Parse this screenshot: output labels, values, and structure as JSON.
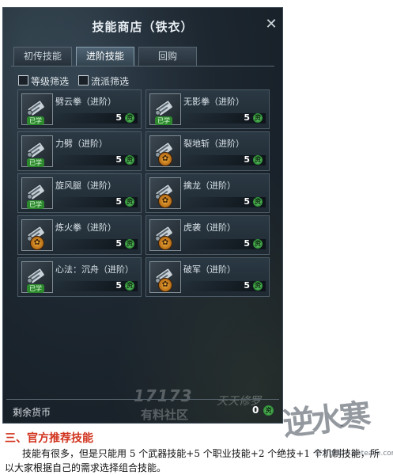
{
  "window": {
    "title": "技能商店（铁衣）",
    "close_glyph": "✕"
  },
  "tabs": [
    {
      "label": "初传技能",
      "active": false
    },
    {
      "label": "进阶技能",
      "active": true
    },
    {
      "label": "回购",
      "active": false
    }
  ],
  "filters": [
    {
      "label": "等级筛选",
      "checked": false
    },
    {
      "label": "流派筛选",
      "checked": false
    }
  ],
  "skills": [
    {
      "name": "劈云拳（进阶）",
      "cost": "5",
      "status": "已学",
      "icon": "scroll-learned-icon"
    },
    {
      "name": "无影拳（进阶）",
      "cost": "5",
      "status": "已学",
      "icon": "scroll-learned-icon"
    },
    {
      "name": "力劈（进阶）",
      "cost": "5",
      "status": "已学",
      "icon": "scroll-learned-icon"
    },
    {
      "name": "裂地斩（进阶）",
      "cost": "5",
      "status": "",
      "icon": "scroll-locked-icon"
    },
    {
      "name": "旋风腿（进阶）",
      "cost": "5",
      "status": "已学",
      "icon": "scroll-learned-icon"
    },
    {
      "name": "擒龙（进阶）",
      "cost": "5",
      "status": "",
      "icon": "scroll-locked-icon"
    },
    {
      "name": "炼火拳（进阶）",
      "cost": "5",
      "status": "",
      "icon": "scroll-locked-icon"
    },
    {
      "name": "虎袭（进阶）",
      "cost": "5",
      "status": "",
      "icon": "scroll-locked-icon"
    },
    {
      "name": "心法：沉舟（进阶）",
      "cost": "5",
      "status": "已学",
      "icon": "scroll-learned-icon"
    },
    {
      "name": "破军（进阶）",
      "cost": "5",
      "status": "",
      "icon": "scroll-locked-icon"
    }
  ],
  "currency_glyph": "资",
  "footer": {
    "remaining_label": "剩余货币",
    "remaining_value": "0"
  },
  "watermarks": {
    "site_logo": "17173",
    "slogan": "有料社区",
    "calligraphy_left": "天天修罗",
    "calligraphy_right": "逆水寒",
    "forum": "官方论坛 n.netease.com"
  },
  "article": {
    "heading": "三、官方推荐技能",
    "paragraph": "技能有很多，但是只能用 5 个武器技能+5 个职业技能+2 个绝技+1 个机制技能，所以大家根据自己的需求选择组合技能。"
  },
  "colors": {
    "heading": "#d1331d",
    "learned_badge": "#2c8a2d",
    "window_bg": "#1d2730"
  }
}
